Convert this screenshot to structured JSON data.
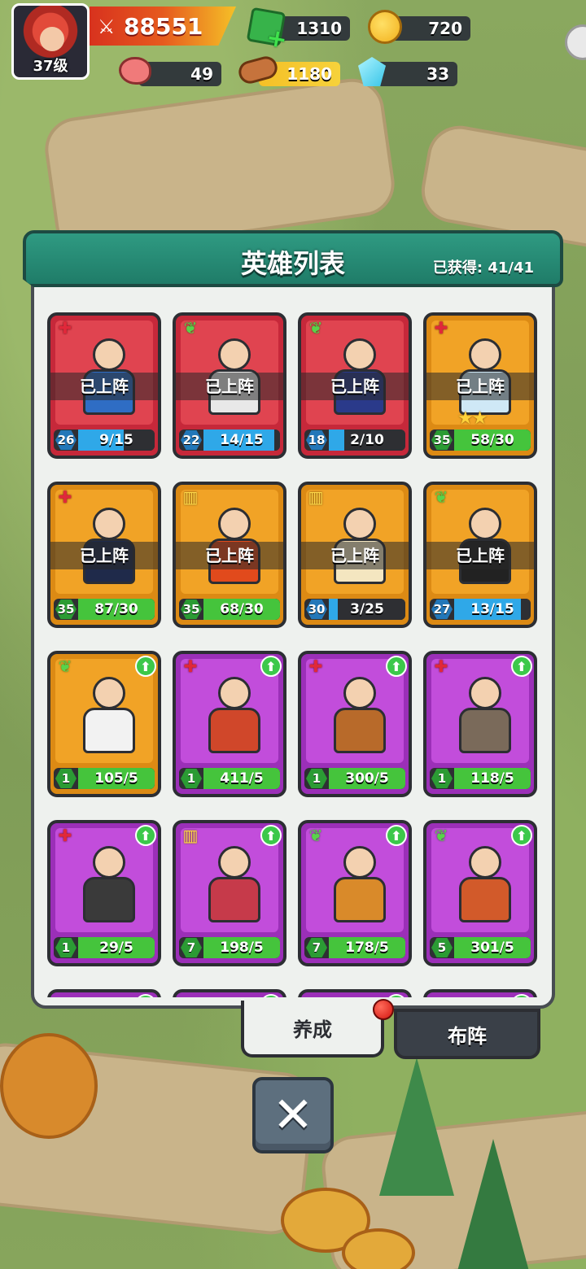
{
  "player": {
    "level": "37级",
    "power": "88551",
    "gems": "1310",
    "gold": "720",
    "meat": "49",
    "wood": "1180",
    "crystal": "33"
  },
  "icons": {
    "power": "crossed-swords-icon",
    "gems": "green-gem-plus-icon",
    "gold": "gold-coin-icon",
    "meat": "meat-icon",
    "wood": "wood-log-icon",
    "crystal": "blue-crystal-icon"
  },
  "panel": {
    "title": "英雄列表",
    "owned": "已获得: 41/41"
  },
  "deployed_label": "已上阵",
  "heroes": [
    {
      "rarity": "red",
      "class": "heal",
      "deployed": true,
      "level": "26",
      "progress": "9/15",
      "fill": 0.6,
      "bar": "blue",
      "stars": 0,
      "upgrade": false
    },
    {
      "rarity": "red",
      "class": "leaf",
      "deployed": true,
      "level": "22",
      "progress": "14/15",
      "fill": 0.93,
      "bar": "blue",
      "stars": 0,
      "upgrade": false
    },
    {
      "rarity": "red",
      "class": "leaf",
      "deployed": true,
      "level": "18",
      "progress": "2/10",
      "fill": 0.2,
      "bar": "blue",
      "stars": 0,
      "upgrade": false
    },
    {
      "rarity": "orange",
      "class": "heal",
      "deployed": true,
      "level": "35",
      "progress": "58/30",
      "fill": 1.0,
      "bar": "green",
      "stars": 2,
      "upgrade": false
    },
    {
      "rarity": "orange",
      "class": "heal",
      "deployed": true,
      "level": "35",
      "progress": "87/30",
      "fill": 1.0,
      "bar": "green",
      "stars": 0,
      "upgrade": false
    },
    {
      "rarity": "orange",
      "class": "book",
      "deployed": true,
      "level": "35",
      "progress": "68/30",
      "fill": 1.0,
      "bar": "green",
      "stars": 0,
      "upgrade": false
    },
    {
      "rarity": "orange",
      "class": "book",
      "deployed": true,
      "level": "30",
      "progress": "3/25",
      "fill": 0.12,
      "bar": "blue",
      "stars": 0,
      "upgrade": false
    },
    {
      "rarity": "orange",
      "class": "leaf",
      "deployed": true,
      "level": "27",
      "progress": "13/15",
      "fill": 0.87,
      "bar": "blue",
      "stars": 0,
      "upgrade": false
    },
    {
      "rarity": "orange",
      "class": "leaf",
      "deployed": false,
      "level": "1",
      "progress": "105/5",
      "fill": 1.0,
      "bar": "green",
      "stars": 0,
      "upgrade": true
    },
    {
      "rarity": "purple",
      "class": "heal",
      "deployed": false,
      "level": "1",
      "progress": "411/5",
      "fill": 1.0,
      "bar": "green",
      "stars": 0,
      "upgrade": true
    },
    {
      "rarity": "purple",
      "class": "heal",
      "deployed": false,
      "level": "1",
      "progress": "300/5",
      "fill": 1.0,
      "bar": "green",
      "stars": 0,
      "upgrade": true
    },
    {
      "rarity": "purple",
      "class": "heal",
      "deployed": false,
      "level": "1",
      "progress": "118/5",
      "fill": 1.0,
      "bar": "green",
      "stars": 0,
      "upgrade": true
    },
    {
      "rarity": "purple",
      "class": "heal",
      "deployed": false,
      "level": "1",
      "progress": "29/5",
      "fill": 1.0,
      "bar": "green",
      "stars": 0,
      "upgrade": true
    },
    {
      "rarity": "purple",
      "class": "book",
      "deployed": false,
      "level": "7",
      "progress": "198/5",
      "fill": 1.0,
      "bar": "green",
      "stars": 0,
      "upgrade": true
    },
    {
      "rarity": "purple",
      "class": "leaf",
      "deployed": false,
      "level": "7",
      "progress": "178/5",
      "fill": 1.0,
      "bar": "green",
      "stars": 0,
      "upgrade": true
    },
    {
      "rarity": "purple",
      "class": "leaf",
      "deployed": false,
      "level": "5",
      "progress": "301/5",
      "fill": 1.0,
      "bar": "green",
      "stars": 0,
      "upgrade": true
    },
    {
      "rarity": "purple",
      "class": "book",
      "deployed": false,
      "level": "",
      "progress": "",
      "fill": 0,
      "bar": "green",
      "stars": 0,
      "upgrade": true
    },
    {
      "rarity": "purple",
      "class": "book",
      "deployed": false,
      "level": "",
      "progress": "",
      "fill": 0,
      "bar": "green",
      "stars": 0,
      "upgrade": true
    },
    {
      "rarity": "purple",
      "class": "book",
      "deployed": false,
      "level": "",
      "progress": "",
      "fill": 0,
      "bar": "green",
      "stars": 0,
      "upgrade": true
    },
    {
      "rarity": "purple",
      "class": "leaf",
      "deployed": false,
      "level": "",
      "progress": "",
      "fill": 0,
      "bar": "green",
      "stars": 0,
      "upgrade": true
    }
  ],
  "hero_colors": [
    "#2f6dc4",
    "#e8e8e8",
    "#2a3a8a",
    "#cfe8f6",
    "#1f2a4a",
    "#e14a1c",
    "#f4e6c0",
    "#222222",
    "#f2f2f2",
    "#d0472a",
    "#b86a2a",
    "#7a6a5a",
    "#3a3a3a",
    "#c63a4a",
    "#d98a2a",
    "#d25a2a",
    "#c24ddb",
    "#c24ddb",
    "#c24ddb",
    "#c24ddb"
  ],
  "tabs": {
    "develop": "养成",
    "formation": "布阵"
  },
  "close_label": "✕",
  "class_glyphs": {
    "heal": "✚",
    "leaf": "❦",
    "book": "▥"
  },
  "upgrade_glyph": "⬆",
  "star_glyph": "★"
}
